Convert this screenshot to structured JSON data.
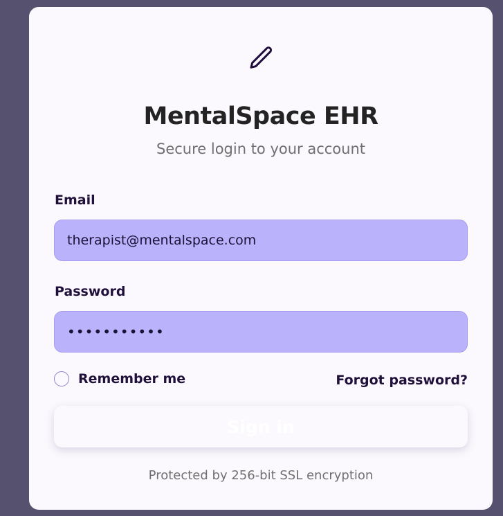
{
  "app": {
    "title": "MentalSpace EHR",
    "subtitle": "Secure login to your account"
  },
  "form": {
    "email_label": "Email",
    "email_value": "therapist@mentalspace.com",
    "password_label": "Password",
    "password_value": "•••••••••••",
    "remember_label": "Remember me",
    "forgot_label": "Forgot password?",
    "signin_label": "Sign in"
  },
  "footer": {
    "text": "Protected by 256-bit SSL encryption"
  },
  "icons": {
    "logo": "pencil-icon"
  },
  "colors": {
    "background": "#575170",
    "card": "#fbf9fd",
    "input_fill": "#bab3fb",
    "text_dark": "#20113a"
  }
}
